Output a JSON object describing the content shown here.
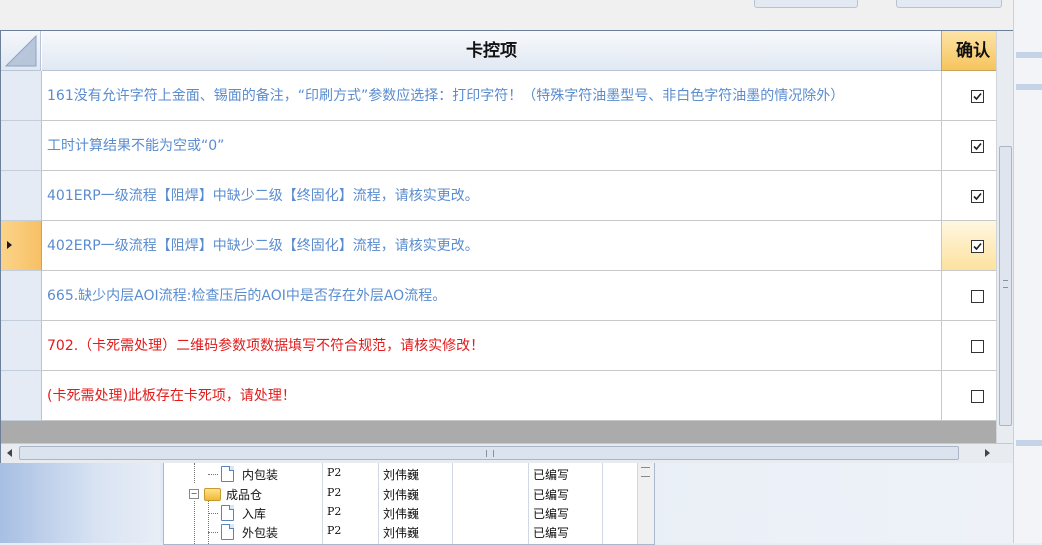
{
  "grid": {
    "columns": {
      "item": "卡控项",
      "confirm": "确认"
    },
    "rows": [
      {
        "text": "161没有允许字符上金面、锡面的备注，“印刷方式”参数应选择：打印字符！（特殊字符油墨型号、非白色字符油墨的情况除外）",
        "color": "#5a8ccf",
        "checked": true,
        "active": false
      },
      {
        "text": "工时计算结果不能为空或“0”",
        "color": "#5a8ccf",
        "checked": true,
        "active": false
      },
      {
        "text": "401ERP一级流程【阻焊】中缺少二级【终固化】流程，请核实更改。",
        "color": "#5a8ccf",
        "checked": true,
        "active": false
      },
      {
        "text": "402ERP一级流程【阻焊】中缺少二级【终固化】流程，请核实更改。",
        "color": "#5a8ccf",
        "checked": true,
        "active": true
      },
      {
        "text": "665.缺少内层AOI流程:检查压后的AOI中是否存在外层AO流程。",
        "color": "#5a8ccf",
        "checked": false,
        "active": false
      },
      {
        "text": "702.（卡死需处理）二维码参数项数据填写不符合规范，请核实修改！",
        "color": "#e21b1b",
        "checked": false,
        "active": false
      },
      {
        "text": "(卡死需处理)此板存在卡死项，请处理！",
        "color": "#e21b1b",
        "checked": false,
        "active": false
      }
    ]
  },
  "background_tree": {
    "rows": [
      {
        "indent": 2,
        "icon": "doc-icon",
        "name": "内包装",
        "code": "P2",
        "person": "刘伟巍",
        "status": "已编写"
      },
      {
        "indent": 1,
        "icon": "folder-icon",
        "name": "成品仓",
        "code": "P2",
        "person": "刘伟巍",
        "status": "已编写"
      },
      {
        "indent": 2,
        "icon": "doc-icon",
        "name": "入库",
        "code": "P2",
        "person": "刘伟巍",
        "status": "已编写"
      },
      {
        "indent": 2,
        "icon": "doc-icon",
        "name": "外包装",
        "code": "P2",
        "person": "刘伟巍",
        "status": "已编写"
      }
    ]
  }
}
